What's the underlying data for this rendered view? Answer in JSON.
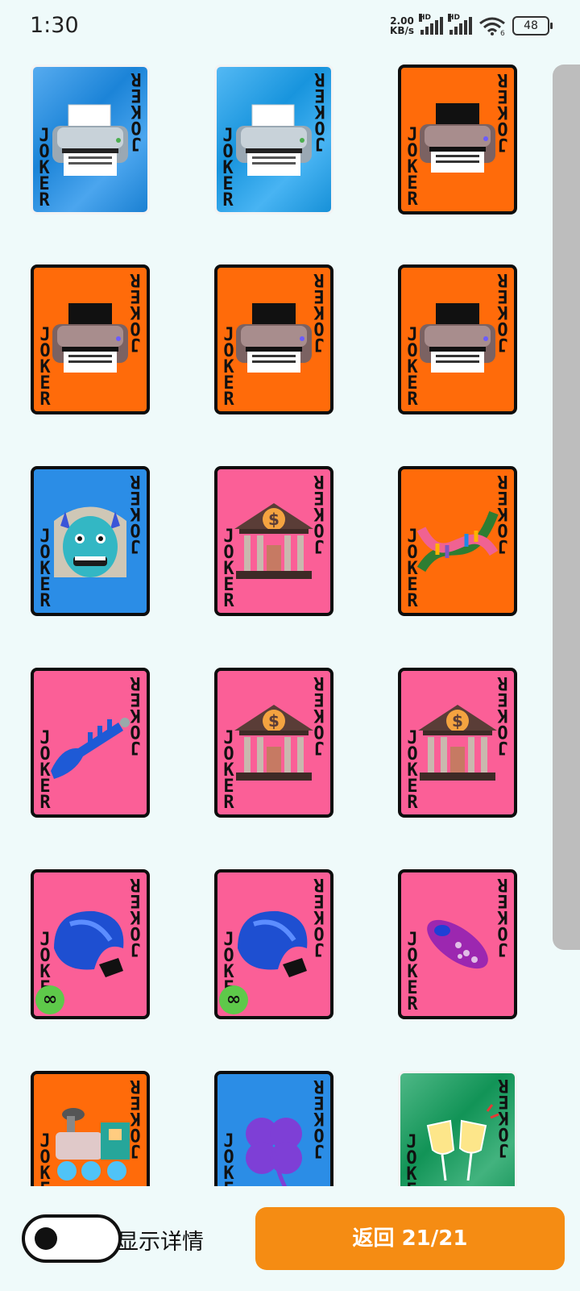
{
  "status_bar": {
    "time": "1:30",
    "net_speed_value": "2.00",
    "net_speed_unit": "KB/s",
    "signal_1_label": "HD",
    "signal_2_label": "HD",
    "wifi_badge": "6",
    "battery": "48"
  },
  "card_label_left": "JOKER",
  "card_label_right": "JOKER",
  "cards": [
    {
      "bg": "#1e8fea",
      "art": "printer-icon",
      "style": "tex-print"
    },
    {
      "bg": "#1aa1f0",
      "art": "printer-icon",
      "style": "tex-print"
    },
    {
      "bg": "#ff6b0a",
      "art": "printer-dark-icon",
      "style": ""
    },
    {
      "bg": "#ff6b0a",
      "art": "printer-dark-icon",
      "style": ""
    },
    {
      "bg": "#ff6b0a",
      "art": "printer-dark-icon",
      "style": ""
    },
    {
      "bg": "#ff6b0a",
      "art": "printer-dark-icon",
      "style": ""
    },
    {
      "bg": "#2b8de6",
      "art": "ogre-icon",
      "style": ""
    },
    {
      "bg": "#fb5f97",
      "art": "bank-icon",
      "style": ""
    },
    {
      "bg": "#ff6b0a",
      "art": "dna-icon",
      "style": ""
    },
    {
      "bg": "#fb5f97",
      "art": "trumpet-icon",
      "style": ""
    },
    {
      "bg": "#fb5f97",
      "art": "bank-icon",
      "style": ""
    },
    {
      "bg": "#fb5f97",
      "art": "bank-icon",
      "style": ""
    },
    {
      "bg": "#fb5f97",
      "art": "fortune-cookie-icon",
      "style": "",
      "badge": "∞"
    },
    {
      "bg": "#fb5f97",
      "art": "fortune-cookie-icon",
      "style": "",
      "badge": "∞"
    },
    {
      "bg": "#fb5f97",
      "art": "microbe-icon",
      "style": ""
    },
    {
      "bg": "#ff6b0a",
      "art": "locomotive-icon",
      "style": ""
    },
    {
      "bg": "#2b8de6",
      "art": "four-leaf-clover-icon",
      "style": ""
    },
    {
      "bg": "#13a05e",
      "art": "champagne-toast-icon",
      "style": "tex-print"
    }
  ],
  "toggle": {
    "label": "显示详情",
    "checked": false
  },
  "back_button": {
    "label": "返回 21/21"
  },
  "colors": {
    "background": "#effafa",
    "accent": "#f58c13",
    "toggle_badge": "#5ec94a"
  }
}
